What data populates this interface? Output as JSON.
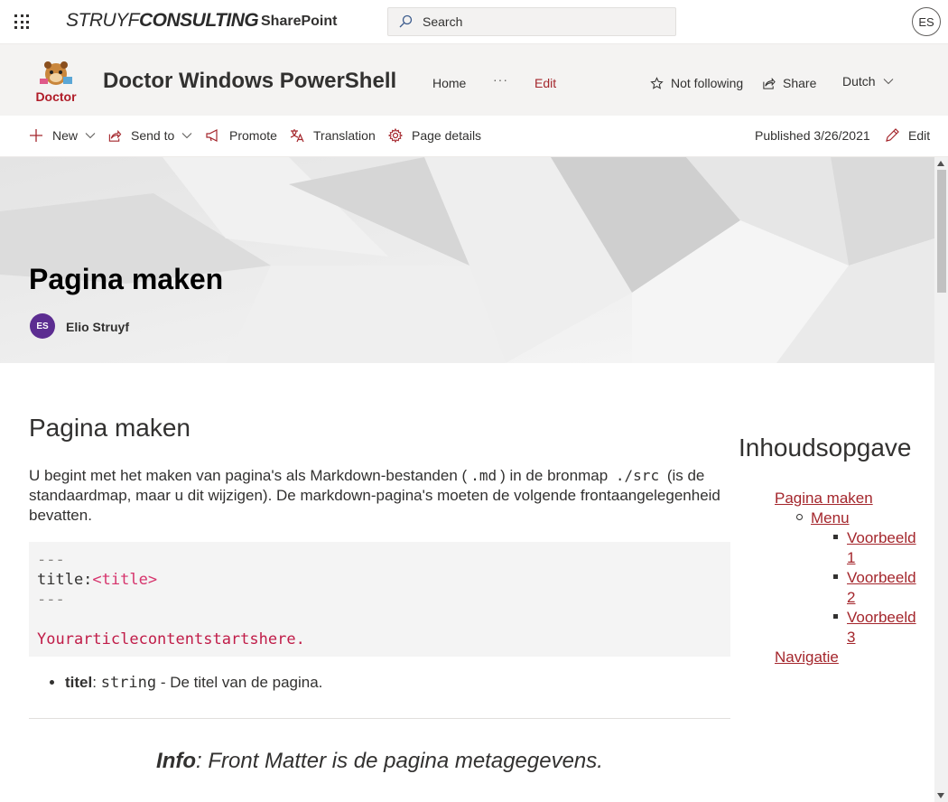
{
  "suitebar": {
    "logo_part1": "STRUYF",
    "logo_part2": "CONSULTING",
    "app_name": "SharePoint",
    "search_placeholder": "Search",
    "user_initials": "ES"
  },
  "site": {
    "logo_text": "Doctor",
    "title": "Doctor Windows PowerShell",
    "nav": {
      "home": "Home",
      "more": "···",
      "edit": "Edit"
    },
    "follow_label": "Not following",
    "share_label": "Share",
    "language": "Dutch"
  },
  "commandbar": {
    "new": "New",
    "send_to": "Send to",
    "promote": "Promote",
    "translation": "Translation",
    "page_details": "Page details",
    "published": "Published 3/26/2021",
    "edit": "Edit"
  },
  "hero": {
    "title": "Pagina maken",
    "author_initials": "ES",
    "author_name": "Elio Struyf"
  },
  "content": {
    "heading": "Pagina maken",
    "para_1": "U begint met het maken van pagina's als Markdown-bestanden (",
    "code_md": ".md",
    "para_2": ") in de bronmap",
    "code_src": "./src",
    "para_3": "(is de standaardmap, maar u dit wijzigen). De markdown-pagina's moeten de volgende frontaangelegenheid bevatten.",
    "code_lines": {
      "dash1": "---",
      "title_key": "title:",
      "title_val": "<title>",
      "dash2": "---",
      "body": "Yourarticlecontentstartshere."
    },
    "bullet_key": "titel",
    "bullet_sep": ":",
    "bullet_type": "string",
    "bullet_desc": " - De titel van de pagina.",
    "info_bold": "Info",
    "info_text": ": Front Matter is de pagina metagegevens."
  },
  "toc": {
    "title": "Inhoudsopgave",
    "item_1": "Pagina maken",
    "item_1_1": "Menu",
    "item_1_1_1a": "Voorbeeld",
    "item_1_1_1b": "1",
    "item_1_1_2a": "Voorbeeld",
    "item_1_1_2b": "2",
    "item_1_1_3a": "Voorbeeld",
    "item_1_1_3b": "3",
    "item_2": "Navigatie"
  },
  "colors": {
    "accent": "#a4262c",
    "header_bg": "#f4f3f2",
    "author_avatar": "#5c2d91",
    "code_red": "#c01c48"
  }
}
